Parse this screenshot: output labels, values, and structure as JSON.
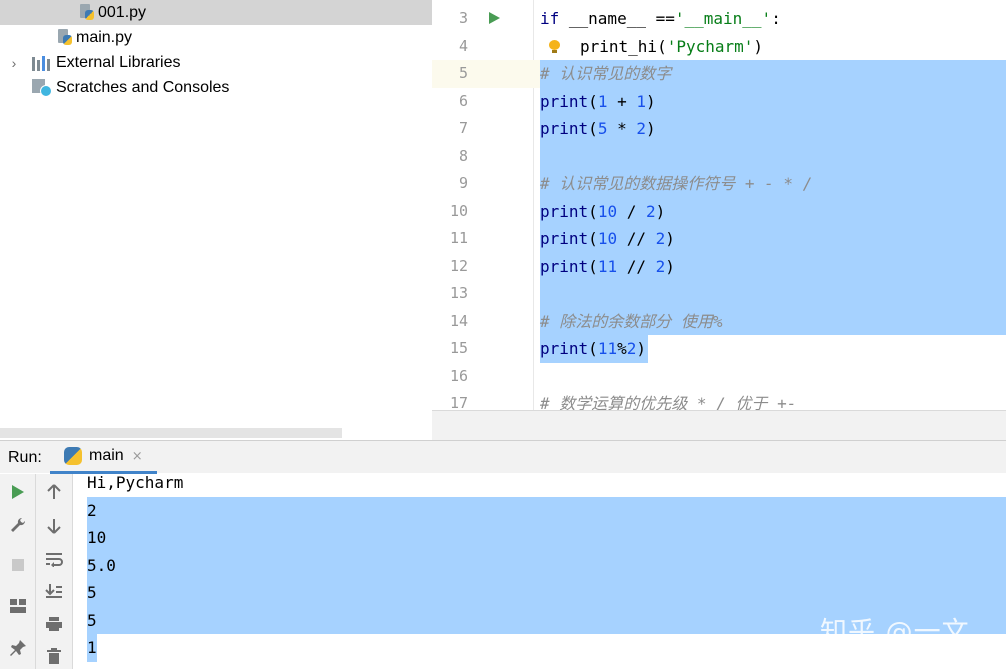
{
  "project_tree": [
    {
      "label": "001.py",
      "icon": "python-file-icon",
      "selected": true
    },
    {
      "label": "main.py",
      "icon": "python-file-icon",
      "selected": false
    },
    {
      "label": "External Libraries",
      "icon": "library-icon",
      "selected": false
    },
    {
      "label": "Scratches and Consoles",
      "icon": "scratches-icon",
      "selected": false
    }
  ],
  "editor": {
    "lines": [
      {
        "number": "3",
        "code": "if __name__ =='__main__':"
      },
      {
        "number": "4",
        "code": "print_hi('Pycharm')"
      },
      {
        "number": "5",
        "code": "# 认识常见的数字"
      },
      {
        "number": "6",
        "code": "print(1 + 1)"
      },
      {
        "number": "7",
        "code": "print(5 * 2)"
      },
      {
        "number": "8",
        "code": ""
      },
      {
        "number": "9",
        "code": "# 认识常见的数据操作符号 + - * /"
      },
      {
        "number": "10",
        "code": "print(10 / 2)"
      },
      {
        "number": "11",
        "code": "print(10 // 2)"
      },
      {
        "number": "12",
        "code": "print(11 // 2)"
      },
      {
        "number": "13",
        "code": ""
      },
      {
        "number": "14",
        "code": "# 除法的余数部分 使用%"
      },
      {
        "number": "15",
        "code": "print(11%2)"
      },
      {
        "number": "16",
        "code": ""
      },
      {
        "number": "17",
        "code": "# 数学运算的优先级 * / 优于 +-"
      }
    ],
    "selection_start_line": "5",
    "selection_end_line": "15",
    "current_line": "5"
  },
  "run_panel": {
    "label": "Run:",
    "tab_label": "main",
    "tab_close": "×",
    "output": [
      "Hi,Pycharm",
      "2",
      "10",
      "5.0",
      "5",
      "5",
      "1"
    ]
  },
  "watermark": "知乎 @一文",
  "colors": {
    "selection": "#a6d2ff",
    "keyword": "#000080",
    "number": "#1750eb",
    "string": "#067d17",
    "comment": "#8c8c8c",
    "run_green": "#499c54",
    "tab_underline": "#4083c9"
  }
}
